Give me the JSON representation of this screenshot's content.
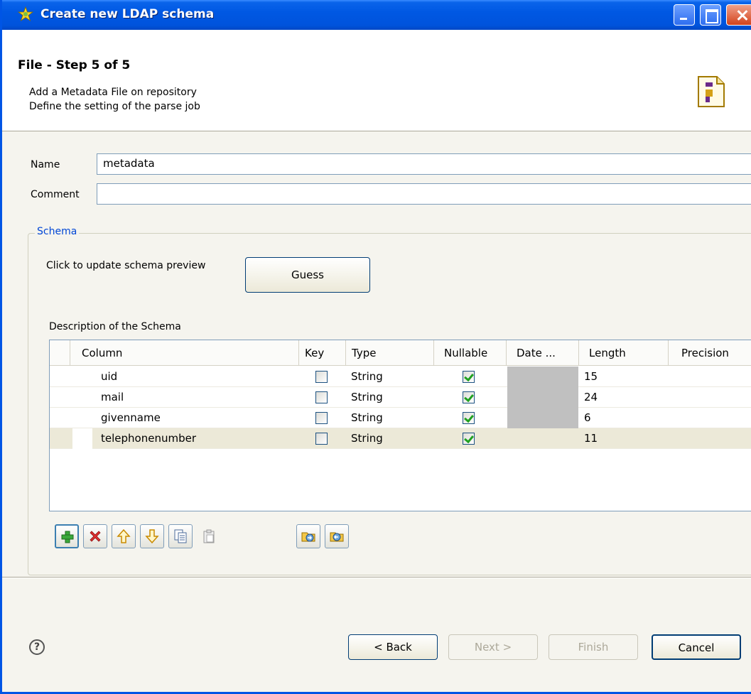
{
  "window": {
    "title": "Create new LDAP schema"
  },
  "header": {
    "step_title": "File - Step 5 of 5",
    "description_line1": "Add a Metadata File on repository",
    "description_line2": "Define the setting of the parse job"
  },
  "form": {
    "name_label": "Name",
    "name_value": "metadata",
    "comment_label": "Comment",
    "comment_value": ""
  },
  "schema": {
    "group_label": "Schema",
    "guess_hint": "Click to update schema preview",
    "guess_button": "Guess",
    "description_label": "Description of the Schema",
    "columns": [
      "Column",
      "Key",
      "Type",
      "Nullable",
      "Date ...",
      "Length",
      "Precision"
    ],
    "rows": [
      {
        "column": "uid",
        "key": false,
        "type": "String",
        "nullable": true,
        "length": "15",
        "precision": ""
      },
      {
        "column": "mail",
        "key": false,
        "type": "String",
        "nullable": true,
        "length": "24",
        "precision": ""
      },
      {
        "column": "givenname",
        "key": false,
        "type": "String",
        "nullable": true,
        "length": "6",
        "precision": ""
      },
      {
        "column": "telephonenumber",
        "key": false,
        "type": "String",
        "nullable": true,
        "length": "11",
        "precision": ""
      }
    ]
  },
  "toolbar_icons": [
    "add-icon",
    "delete-icon",
    "move-up-icon",
    "move-down-icon",
    "copy-icon",
    "paste-icon",
    "import-icon",
    "export-icon"
  ],
  "footer": {
    "back": "< Back",
    "next": "Next >",
    "finish": "Finish",
    "cancel": "Cancel"
  },
  "colors": {
    "titlebar": "#0058e3",
    "accent_blue": "#0046d5",
    "check_green": "#21a121"
  }
}
